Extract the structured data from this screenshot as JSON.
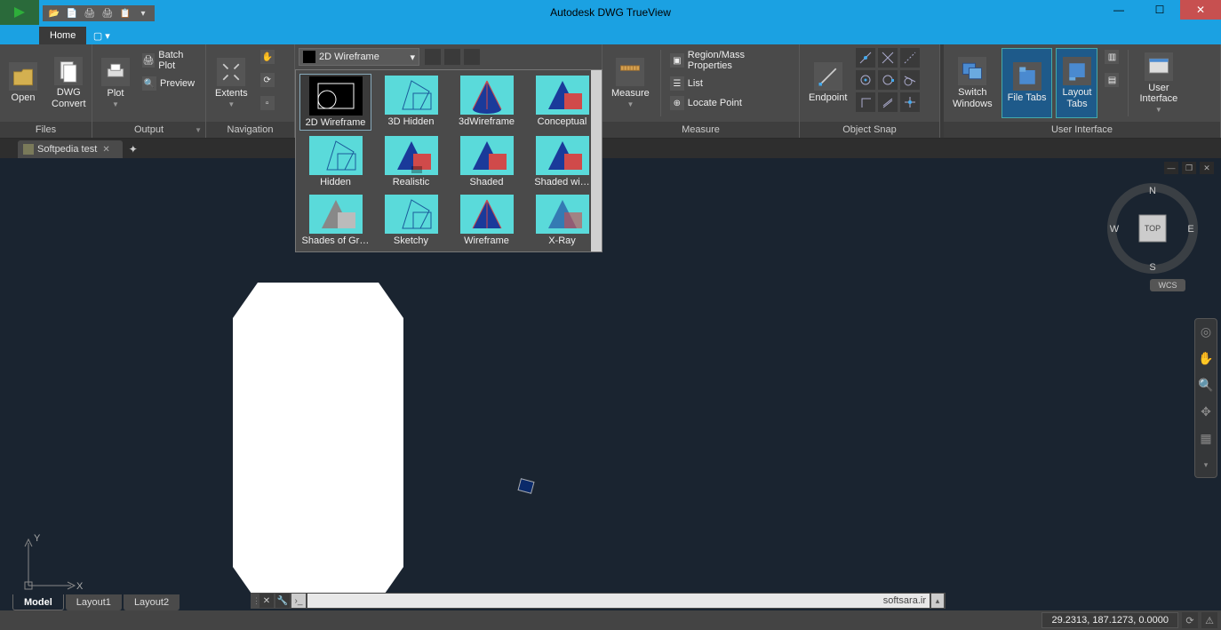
{
  "title": "Autodesk DWG TrueView",
  "ribbon_tab_active": "Home",
  "panels": {
    "files": {
      "title": "Files",
      "open": "Open",
      "dwg": "DWG\nConvert"
    },
    "output": {
      "title": "Output",
      "plot": "Plot",
      "batch": "Batch Plot",
      "preview": "Preview"
    },
    "nav": {
      "title": "Navigation",
      "extents": "Extents"
    },
    "visual": {
      "combo": "2D Wireframe"
    },
    "measure": {
      "title": "Measure",
      "measure": "Measure",
      "region": "Region/Mass Properties",
      "list": "List",
      "locate": "Locate Point"
    },
    "osnap": {
      "title": "Object Snap",
      "endpoint": "Endpoint"
    },
    "ui": {
      "title": "User Interface",
      "switch": "Switch\nWindows",
      "filetabs": "File Tabs",
      "layouttabs": "Layout\nTabs",
      "user": "User\nInterface"
    }
  },
  "gallery": [
    "2D Wireframe",
    "3D Hidden",
    "3dWireframe",
    "Conceptual",
    "Hidden",
    "Realistic",
    "Shaded",
    "Shaded wi…",
    "Shades of Gray",
    "Sketchy",
    "Wireframe",
    "X-Ray"
  ],
  "doc_tab": "Softpedia test",
  "layout_tabs": [
    "Model",
    "Layout1",
    "Layout2"
  ],
  "viewcube": {
    "n": "N",
    "e": "E",
    "s": "S",
    "w": "W",
    "top": "TOP"
  },
  "wcs": "WCS",
  "cmdbar_text": "softsara.ir",
  "status_coord": "29.2313, 187.1273, 0.0000",
  "ucs": {
    "x": "X",
    "y": "Y"
  }
}
